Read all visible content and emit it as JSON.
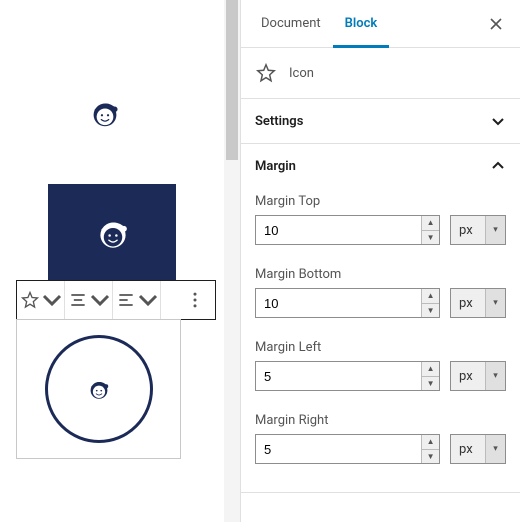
{
  "canvas": {
    "icon_brand": "mailchimp-logo"
  },
  "toolbar": {
    "star": "star-icon",
    "align1": "align-center-icon",
    "align2": "align-left-icon",
    "more": "more-icon"
  },
  "sidebar": {
    "tabs": {
      "document": "Document",
      "block": "Block"
    },
    "close": "×",
    "block_type": {
      "icon": "star-icon",
      "label": "Icon"
    },
    "panels": {
      "settings": {
        "title": "Settings",
        "open": false
      },
      "margin": {
        "title": "Margin",
        "open": true,
        "unit_options": [
          "px"
        ],
        "fields": [
          {
            "label": "Margin Top",
            "value": "10",
            "unit": "px"
          },
          {
            "label": "Margin Bottom",
            "value": "10",
            "unit": "px"
          },
          {
            "label": "Margin Left",
            "value": "5",
            "unit": "px"
          },
          {
            "label": "Margin Right",
            "value": "5",
            "unit": "px"
          }
        ]
      }
    }
  }
}
